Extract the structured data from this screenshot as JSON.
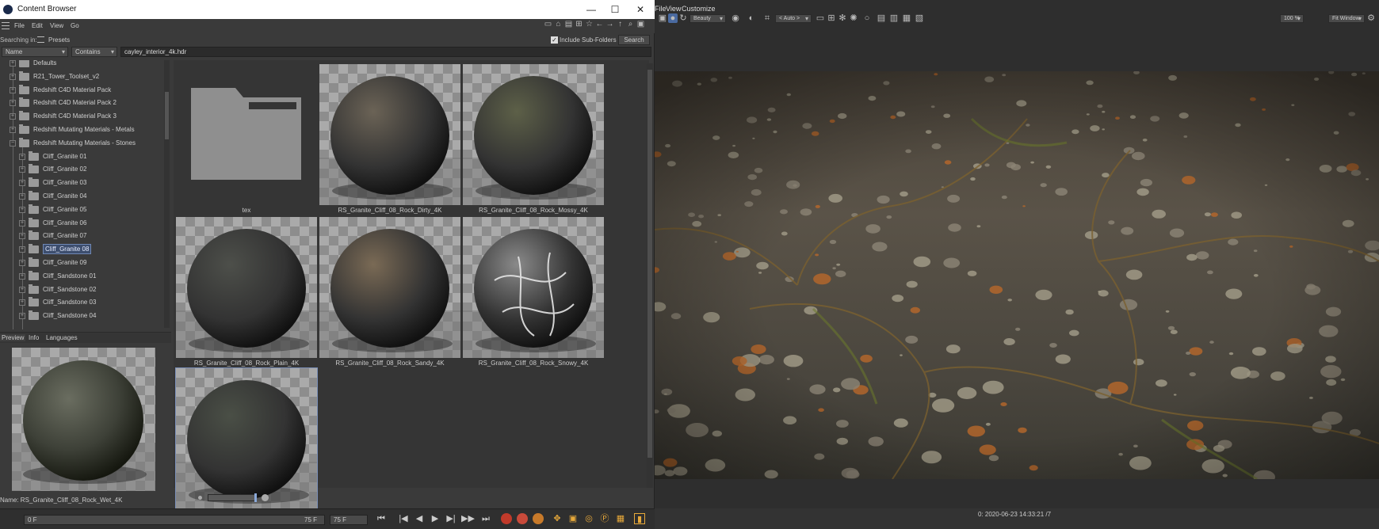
{
  "content_browser": {
    "title": "Content Browser",
    "window_buttons": {
      "minimize": "—",
      "maximize": "☐",
      "close": "✕"
    },
    "menu": [
      "File",
      "Edit",
      "View",
      "Go"
    ],
    "searching_in_label": "Searching in:",
    "searching_in_value": "Presets",
    "include_subfolders_label": "Include Sub-Folders",
    "include_subfolders_checked": true,
    "search_button": "Search",
    "filter_field": "Name",
    "filter_operator": "Contains",
    "search_text": "cayley_interior_4k.hdr",
    "tree": [
      {
        "label": "Defaults",
        "level": 1
      },
      {
        "label": "R21_Tower_Toolset_v2",
        "level": 1
      },
      {
        "label": "Redshift C4D Material Pack",
        "level": 1
      },
      {
        "label": "Redshift C4D Material Pack 2",
        "level": 1
      },
      {
        "label": "Redshift C4D Material Pack 3",
        "level": 1
      },
      {
        "label": "Redshift Mutating Materials - Metals",
        "level": 1
      },
      {
        "label": "Redshift Mutating Materials - Stones",
        "level": 1,
        "expanded": true
      },
      {
        "label": "Cliff_Granite 01",
        "level": 2
      },
      {
        "label": "Cliff_Granite 02",
        "level": 2
      },
      {
        "label": "Cliff_Granite 03",
        "level": 2
      },
      {
        "label": "Cliff_Granite 04",
        "level": 2
      },
      {
        "label": "Cliff_Granite 05",
        "level": 2
      },
      {
        "label": "Cliff_Granite 06",
        "level": 2
      },
      {
        "label": "Cliff_Granite 07",
        "level": 2
      },
      {
        "label": "Cliff_Granite 08",
        "level": 2,
        "selected": true
      },
      {
        "label": "Cliff_Granite 09",
        "level": 2
      },
      {
        "label": "Cliff_Sandstone 01",
        "level": 2
      },
      {
        "label": "Cliff_Sandstone 02",
        "level": 2
      },
      {
        "label": "Cliff_Sandstone 03",
        "level": 2
      },
      {
        "label": "Cliff_Sandstone 04",
        "level": 2
      }
    ],
    "preview_tabs": [
      "Preview",
      "Info",
      "Languages"
    ],
    "preview_name_label": "Name:",
    "preview_name": "RS_Granite_Cliff_08_Rock_Wet_4K",
    "tiles": [
      {
        "label": "tex",
        "kind": "folder"
      },
      {
        "label": "RS_Granite_Cliff_08_Rock_Dirty_4K",
        "kind": "material",
        "tint": "#6b6356"
      },
      {
        "label": "RS_Granite_Cliff_08_Rock_Mossy_4K",
        "kind": "material",
        "tint": "#5d6048"
      },
      {
        "label": "RS_Granite_Cliff_08_Rock_Plain_4K",
        "kind": "material",
        "tint": "#4d4f4a"
      },
      {
        "label": "RS_Granite_Cliff_08_Rock_Sandy_4K",
        "kind": "material",
        "tint": "#7a6a55"
      },
      {
        "label": "RS_Granite_Cliff_08_Rock_Snowy_4K",
        "kind": "material",
        "tint": "#8a8a8a"
      },
      {
        "label": "",
        "kind": "material",
        "tint": "#4a4f46",
        "selected": true
      }
    ]
  },
  "picture_viewer": {
    "menu": [
      "File",
      "View",
      "Customize"
    ],
    "render_mode": "Beauty",
    "auto_label": "< Auto >",
    "zoom": "100 %",
    "fit_label": "Fit Window",
    "status": "0:  2020-06-23  14:33:21  /7"
  },
  "timeline": {
    "current_frame": "0 F",
    "end_frame": "75 F",
    "end_frame_field": "75 F"
  },
  "colors": {
    "panel_bg": "#3a3a3a",
    "selection": "#6f87b4",
    "accent_orange": "#e8a93a"
  }
}
